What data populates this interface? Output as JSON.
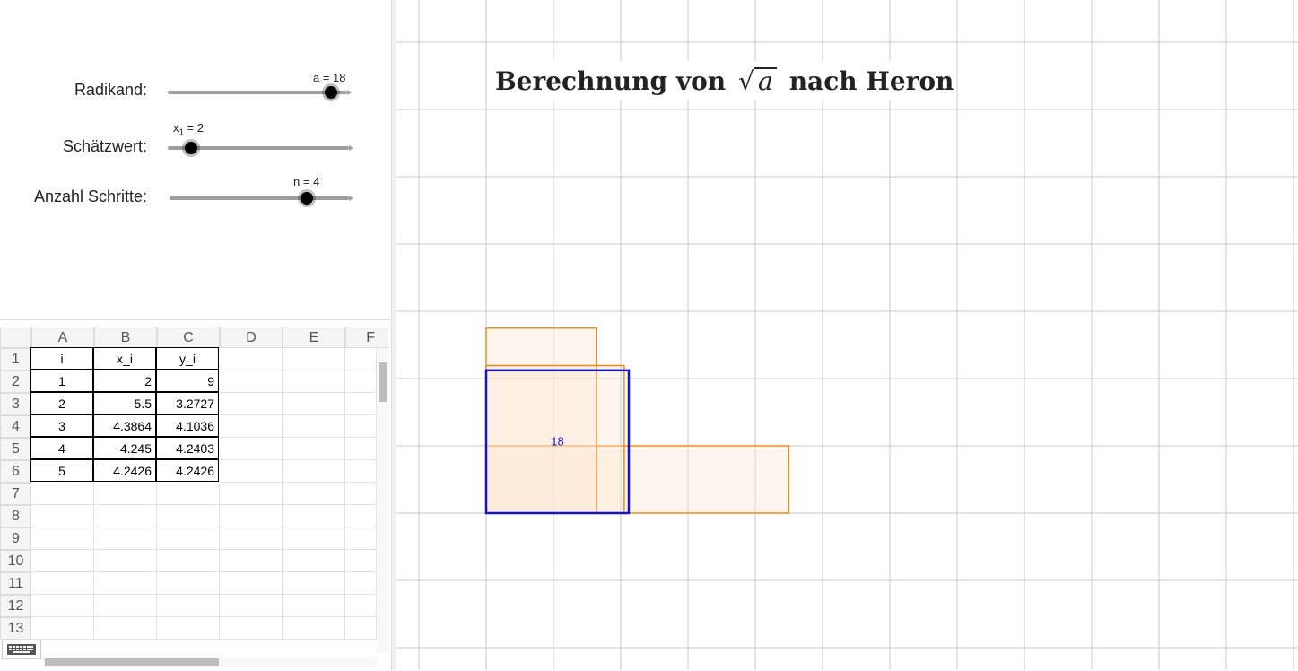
{
  "sliders": [
    {
      "label": "Radikand:",
      "value_text": "a = 18",
      "fraction": 0.88
    },
    {
      "label": "Schätzwert:",
      "value_prefix": "x",
      "value_sub": "1",
      "value_suffix": " = 2",
      "fraction": 0.12
    },
    {
      "label": "Anzahl Schritte:",
      "value_text": "n = 4",
      "fraction": 0.75
    }
  ],
  "spreadsheet": {
    "columns": [
      "A",
      "B",
      "C",
      "D",
      "E",
      "F"
    ],
    "rows": [
      "1",
      "2",
      "3",
      "4",
      "5",
      "6",
      "7",
      "8",
      "9",
      "10",
      "11",
      "12",
      "13"
    ],
    "header": [
      "i",
      "x_i",
      "y_i"
    ],
    "data": [
      [
        "1",
        "2",
        "9"
      ],
      [
        "2",
        "5.5",
        "3.2727"
      ],
      [
        "3",
        "4.3864",
        "4.1036"
      ],
      [
        "4",
        "4.245",
        "4.2403"
      ],
      [
        "5",
        "4.2426",
        "4.2426"
      ]
    ]
  },
  "graphics": {
    "title_before": "Berechnung von",
    "title_var": "a",
    "title_after": "nach Heron",
    "area_label": "18",
    "colors": {
      "orange": "#f08a1e",
      "blue": "#1414c8",
      "grid": "#c8c8c8",
      "fill": "#fde6cf"
    }
  }
}
